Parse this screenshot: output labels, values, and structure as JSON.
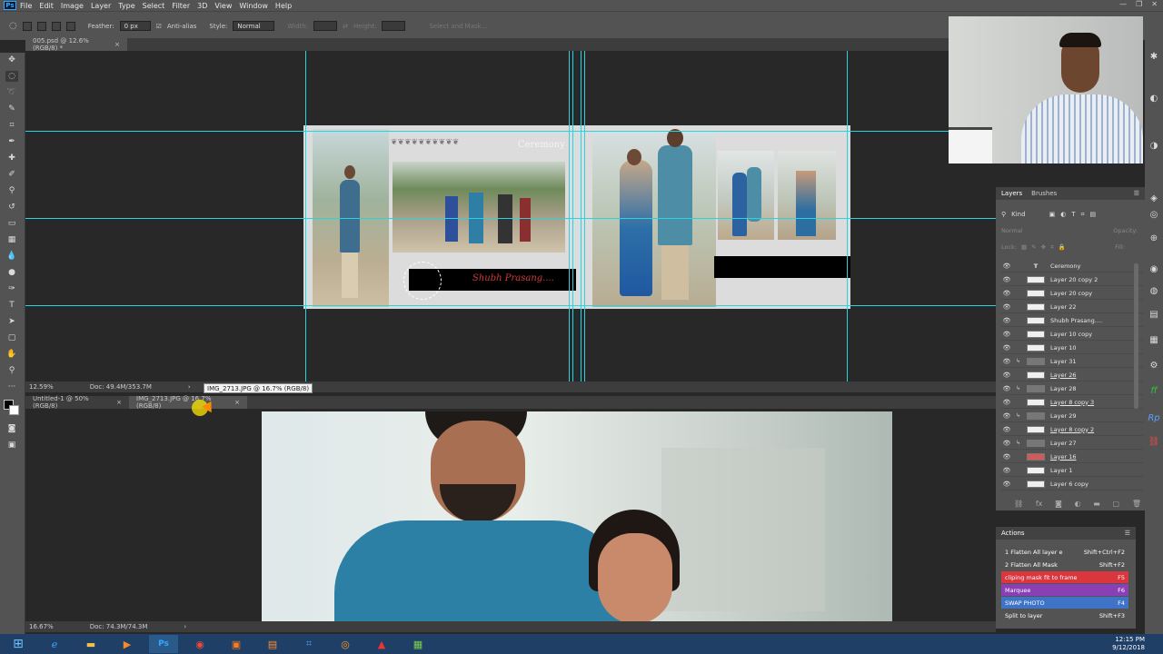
{
  "menu": {
    "items": [
      "File",
      "Edit",
      "Image",
      "Layer",
      "Type",
      "Select",
      "Filter",
      "3D",
      "View",
      "Window",
      "Help"
    ]
  },
  "options": {
    "feather_label": "Feather:",
    "feather_value": "0 px",
    "antialias_label": "Anti-alias",
    "style_label": "Style:",
    "style_value": "Normal",
    "width_label": "Width:",
    "height_label": "Height:",
    "select_mask_label": "Select and Mask..."
  },
  "doc1": {
    "tab_title": "005.psd @ 12.6% (RGB/8) *",
    "zoom": "12.59%",
    "doc_info": "Doc: 49.4M/353.7M"
  },
  "album": {
    "ceremony_text": "Ceremony",
    "banner_text": "Shubh Prasang....",
    "ornament_text": "❦❦❦❦❦❦❦❦❦❦"
  },
  "tooltip": "IMG_2713.JPG @ 16.7% (RGB/8)",
  "doc2": {
    "tab1": "Untitled-1 @ 50% (RGB/8)",
    "tab2": "IMG_2713.JPG @ 16.7% (RGB/8)",
    "zoom": "16.67%",
    "doc_info": "Doc: 74.3M/74.3M"
  },
  "layers_panel": {
    "tab_layers": "Layers",
    "tab_brushes": "Brushes",
    "kind_label": "Kind",
    "blend_mode": "Normal",
    "opacity_label": "Opacity:",
    "lock_label": "Lock:",
    "fill_label": "Fill:",
    "layers": [
      {
        "name": "Ceremony",
        "type": "text"
      },
      {
        "name": "Layer 20 copy 2",
        "type": "pixel"
      },
      {
        "name": "Layer 20 copy",
        "type": "pixel"
      },
      {
        "name": "Layer 22",
        "type": "pixel"
      },
      {
        "name": "Shubh Prasang....",
        "type": "pixel"
      },
      {
        "name": "Layer 10 copy",
        "type": "pixel"
      },
      {
        "name": "Layer 10",
        "type": "pixel"
      },
      {
        "name": "Layer 31",
        "type": "clip"
      },
      {
        "name": "Layer 26",
        "type": "pixel"
      },
      {
        "name": "Layer 28",
        "type": "clip"
      },
      {
        "name": "Layer 8 copy 3",
        "type": "pixel"
      },
      {
        "name": "Layer 29",
        "type": "clip"
      },
      {
        "name": "Layer 8 copy 2",
        "type": "pixel"
      },
      {
        "name": "Layer 27",
        "type": "clip"
      },
      {
        "name": "Layer 16",
        "type": "pixel"
      },
      {
        "name": "Layer 1",
        "type": "pixel"
      },
      {
        "name": "Layer 6 copy",
        "type": "pixel"
      }
    ]
  },
  "actions_panel": {
    "title": "Actions",
    "items": [
      {
        "name": "1  Flatten All layer e",
        "key": "Shift+Ctrl+F2",
        "color": "#535353"
      },
      {
        "name": "2 Flatten All Mask",
        "key": "Shift+F2",
        "color": "#535353"
      },
      {
        "name": "cliping mask fit to frame",
        "key": "F5",
        "color": "#d9363e"
      },
      {
        "name": "Marquee",
        "key": "F6",
        "color": "#8a3fb5"
      },
      {
        "name": "SWAP PHOTO",
        "key": "F4",
        "color": "#3f73c8"
      },
      {
        "name": "Split to layer",
        "key": "Shift+F3",
        "color": "#535353"
      }
    ]
  },
  "clock": {
    "time": "12:15 PM",
    "date": "9/12/2018"
  },
  "colors": {
    "guide": "#27d5e0",
    "panel": "#535353",
    "canvas": "#282828",
    "banner": "#a01818"
  },
  "icons": {
    "eye": "eye-icon",
    "lock": "lock-icon"
  }
}
